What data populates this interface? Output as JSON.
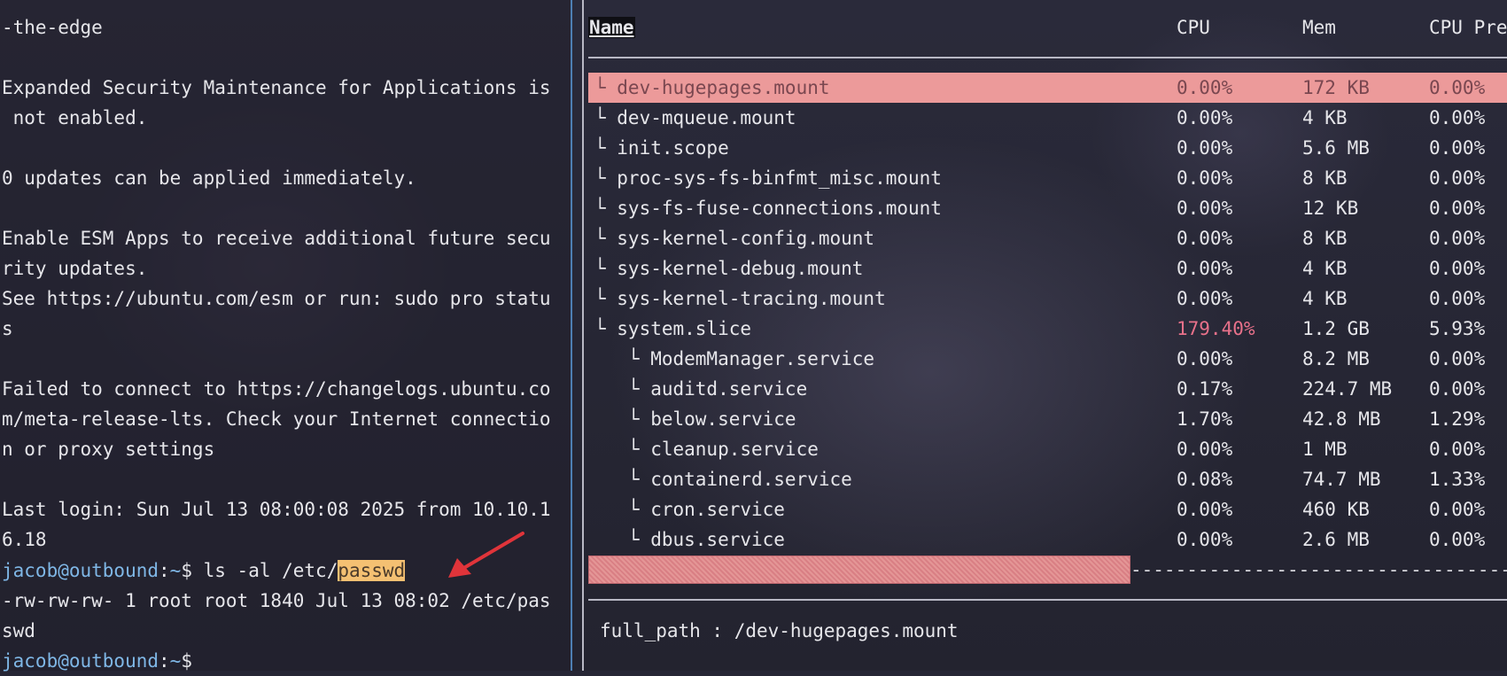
{
  "terminal": {
    "lines": [
      "-the-edge",
      "",
      "Expanded Security Maintenance for Applications is",
      " not enabled.",
      "",
      "0 updates can be applied immediately.",
      "",
      "Enable ESM Apps to receive additional future secu",
      "rity updates.",
      "See https://ubuntu.com/esm or run: sudo pro statu",
      "s",
      "",
      "Failed to connect to https://changelogs.ubuntu.co",
      "m/meta-release-lts. Check your Internet connectio",
      "n or proxy settings",
      "",
      "Last login: Sun Jul 13 08:00:08 2025 from 10.10.1",
      "6.18"
    ],
    "prompt_user": "jacob@outbound",
    "prompt_sep": ":",
    "prompt_path": "~",
    "prompt_symbol": "$ ",
    "command_prefix": "ls -al /etc/",
    "command_highlight": "passwd",
    "output_lines": [
      "-rw-rw-rw- 1 root root 1840 Jul 13 08:02 /etc/pas",
      "swd"
    ],
    "colors": {
      "prompt": "#7fb7e6",
      "highlight": "#f4c072",
      "arrow": "#e0343a"
    }
  },
  "below": {
    "columns": [
      "Name",
      "CPU",
      "Mem",
      "CPU Pre"
    ],
    "rows": [
      {
        "name": "└ dev-hugepages.mount",
        "cpu": "0.00%",
        "mem": "172 KB",
        "cpu_pre": "0.00%",
        "selected": true
      },
      {
        "name": "└ dev-mqueue.mount",
        "cpu": "0.00%",
        "mem": "4 KB",
        "cpu_pre": "0.00%"
      },
      {
        "name": "└ init.scope",
        "cpu": "0.00%",
        "mem": "5.6 MB",
        "cpu_pre": "0.00%"
      },
      {
        "name": "└ proc-sys-fs-binfmt_misc.mount",
        "cpu": "0.00%",
        "mem": "8 KB",
        "cpu_pre": "0.00%"
      },
      {
        "name": "└ sys-fs-fuse-connections.mount",
        "cpu": "0.00%",
        "mem": "12 KB",
        "cpu_pre": "0.00%"
      },
      {
        "name": "└ sys-kernel-config.mount",
        "cpu": "0.00%",
        "mem": "8 KB",
        "cpu_pre": "0.00%"
      },
      {
        "name": "└ sys-kernel-debug.mount",
        "cpu": "0.00%",
        "mem": "4 KB",
        "cpu_pre": "0.00%"
      },
      {
        "name": "└ sys-kernel-tracing.mount",
        "cpu": "0.00%",
        "mem": "4 KB",
        "cpu_pre": "0.00%"
      },
      {
        "name": "└ system.slice",
        "cpu": "179.40%",
        "mem": "1.2 GB",
        "cpu_pre": "5.93%",
        "cpu_warn": true
      },
      {
        "name": "   └ ModemManager.service",
        "cpu": "0.00%",
        "mem": "8.2 MB",
        "cpu_pre": "0.00%"
      },
      {
        "name": "   └ auditd.service",
        "cpu": "0.17%",
        "mem": "224.7 MB",
        "cpu_pre": "0.00%"
      },
      {
        "name": "   └ below.service",
        "cpu": "1.70%",
        "mem": "42.8 MB",
        "cpu_pre": "1.29%"
      },
      {
        "name": "   └ cleanup.service",
        "cpu": "0.00%",
        "mem": "1 MB",
        "cpu_pre": "0.00%"
      },
      {
        "name": "   └ containerd.service",
        "cpu": "0.08%",
        "mem": "74.7 MB",
        "cpu_pre": "1.33%"
      },
      {
        "name": "   └ cron.service",
        "cpu": "0.00%",
        "mem": "460 KB",
        "cpu_pre": "0.00%"
      },
      {
        "name": "   └ dbus.service",
        "cpu": "0.00%",
        "mem": "2.6 MB",
        "cpu_pre": "0.00%"
      }
    ],
    "bar_dashes": "----------------------------------------------------------",
    "full_path": "full_path : /dev-hugepages.mount",
    "colors": {
      "selected_bg": "#ec9a9a",
      "warn": "#e8718a"
    }
  }
}
